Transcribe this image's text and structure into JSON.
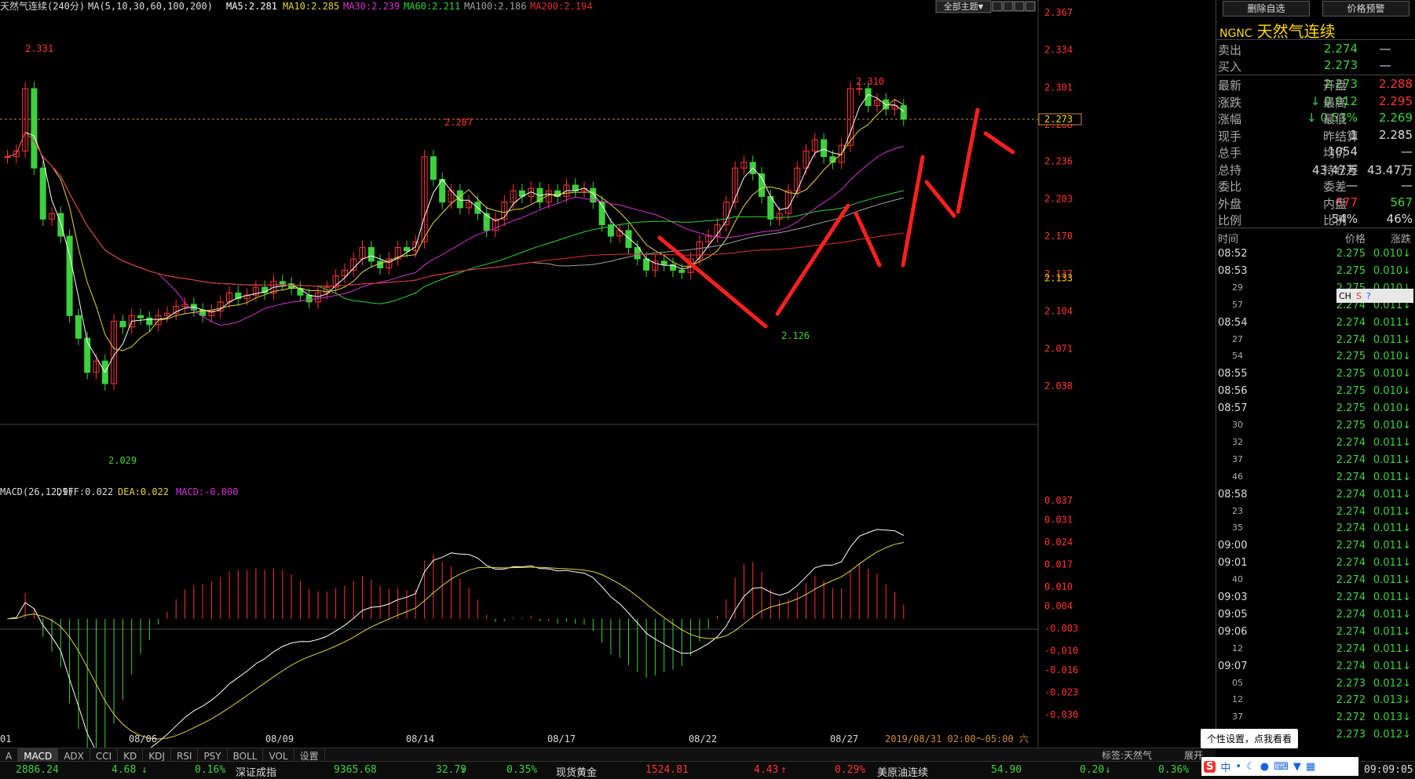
{
  "header": {
    "title": "天然气连续(240分)",
    "ma_label": "MA(5,10,30,60,100,200)",
    "ma5": "MA5:2.281",
    "ma10": "MA10:2.285",
    "ma30": "MA30:2.239",
    "ma60": "MA60:2.211",
    "ma100": "MA100:2.186",
    "ma200": "MA200:2.194",
    "theme_button": "全部主题▼"
  },
  "colors": {
    "up": "#ff3333",
    "down": "#3dd13d",
    "ma5": "#ffffff",
    "ma10": "#e6d23a",
    "ma30": "#d62fd6",
    "ma60": "#2fd62f",
    "ma100": "#a0a0a0",
    "ma200": "#e03030",
    "accent": "#ffd700"
  },
  "price_axis": [
    "2.367",
    "2.334",
    "2.301",
    "2.268",
    "2.236",
    "2.203",
    "2.170",
    "2.137",
    "2.104",
    "2.071",
    "2.038"
  ],
  "price_axis_current": "2.273",
  "price_axis_low": "2.133",
  "annotations": {
    "high1": "2.331",
    "high2": "2.287",
    "high3": "2.310",
    "low1": "2.029",
    "low2": "2.126"
  },
  "dates": [
    "01",
    "08/06",
    "08/09",
    "08/14",
    "08/17",
    "08/22",
    "08/27"
  ],
  "date_range": "2019/08/31 02:00～05:00 六",
  "macd": {
    "label": "MACD(26,12,9)",
    "diff": "DIFF:0.022",
    "dea": "DEA:0.022",
    "macd": "MACD:-0.000",
    "axis": [
      "0.037",
      "0.031",
      "0.024",
      "0.017",
      "0.010",
      "0.004",
      "-0.003",
      "-0.010",
      "-0.016",
      "-0.023",
      "-0.030"
    ]
  },
  "bottom_tabs": [
    "A",
    "MACD",
    "ADX",
    "CCI",
    "KD",
    "KDJ",
    "RSI",
    "PSY",
    "BOLL",
    "VOL",
    "设置"
  ],
  "right_panel": {
    "buttons": [
      "删除自选",
      "价格预警"
    ],
    "code": "NGNC",
    "name": "天然气连续",
    "sell_label": "卖出",
    "sell": "2.274",
    "sell_vol": "—",
    "buy_label": "买入",
    "buy": "2.273",
    "buy_vol": "—",
    "rows": [
      {
        "l1": "最新",
        "v1": "2.273",
        "l2": "开盘",
        "v2": "2.288",
        "c1": "#3dd13d",
        "c2": "#ff3333"
      },
      {
        "l1": "涨跌",
        "v1": "0.012",
        "l2": "最高",
        "v2": "2.295",
        "c1": "#3dd13d",
        "c2": "#ff3333",
        "arrow": "↓"
      },
      {
        "l1": "涨幅",
        "v1": "0.53%",
        "l2": "最低",
        "v2": "2.269",
        "c1": "#3dd13d",
        "c2": "#3dd13d",
        "arrow": "↓"
      },
      {
        "l1": "现手",
        "v1": "1",
        "l2": "昨结算",
        "v2": "2.285",
        "c1": "#ddd",
        "c2": "#ddd"
      },
      {
        "l1": "总手",
        "v1": "1054",
        "l2": "均价",
        "v2": "—",
        "c1": "#ddd",
        "c2": "#ddd"
      },
      {
        "l1": "总持",
        "v1": "43.47万",
        "l2": "持仓差",
        "v2": "43.47万",
        "c1": "#ddd",
        "c2": "#ddd"
      },
      {
        "l1": "委比",
        "v1": "—",
        "l2": "委差",
        "v2": "—",
        "c1": "#ddd",
        "c2": "#ddd"
      },
      {
        "l1": "外盘",
        "v1": "677",
        "l2": "内盘",
        "v2": "567",
        "c1": "#ff3333",
        "c2": "#3dd13d"
      },
      {
        "l1": "比例",
        "v1": "54%",
        "l2": "比例",
        "v2": "46%",
        "c1": "#ddd",
        "c2": "#ddd"
      }
    ],
    "tick_header": {
      "time": "时间",
      "price": "价格",
      "chg": "涨跌"
    },
    "ticks": [
      {
        "t": "08:52",
        "p": "2.275",
        "c": "0.010"
      },
      {
        "t": "08:53",
        "p": "2.275",
        "c": "0.010"
      },
      {
        "t": "29",
        "p": "2.275",
        "c": "0.010",
        "sub": true
      },
      {
        "t": "57",
        "p": "2.274",
        "c": "0.011",
        "sub": true
      },
      {
        "t": "08:54",
        "p": "2.274",
        "c": "0.011"
      },
      {
        "t": "27",
        "p": "2.274",
        "c": "0.011",
        "sub": true
      },
      {
        "t": "54",
        "p": "2.275",
        "c": "0.010",
        "sub": true
      },
      {
        "t": "08:55",
        "p": "2.275",
        "c": "0.010"
      },
      {
        "t": "08:56",
        "p": "2.275",
        "c": "0.010"
      },
      {
        "t": "08:57",
        "p": "2.275",
        "c": "0.010"
      },
      {
        "t": "30",
        "p": "2.275",
        "c": "0.010",
        "sub": true
      },
      {
        "t": "32",
        "p": "2.274",
        "c": "0.011",
        "sub": true
      },
      {
        "t": "37",
        "p": "2.274",
        "c": "0.011",
        "sub": true
      },
      {
        "t": "46",
        "p": "2.274",
        "c": "0.011",
        "sub": true
      },
      {
        "t": "08:58",
        "p": "2.274",
        "c": "0.011"
      },
      {
        "t": "23",
        "p": "2.274",
        "c": "0.011",
        "sub": true
      },
      {
        "t": "35",
        "p": "2.274",
        "c": "0.011",
        "sub": true
      },
      {
        "t": "09:00",
        "p": "2.274",
        "c": "0.011"
      },
      {
        "t": "09:01",
        "p": "2.274",
        "c": "0.011"
      },
      {
        "t": "40",
        "p": "2.274",
        "c": "0.011",
        "sub": true
      },
      {
        "t": "09:03",
        "p": "2.274",
        "c": "0.011"
      },
      {
        "t": "09:05",
        "p": "2.274",
        "c": "0.011"
      },
      {
        "t": "09:06",
        "p": "2.274",
        "c": "0.011"
      },
      {
        "t": "12",
        "p": "2.274",
        "c": "0.011",
        "sub": true
      },
      {
        "t": "09:07",
        "p": "2.274",
        "c": "0.011"
      },
      {
        "t": "05",
        "p": "2.273",
        "c": "0.012",
        "sub": true
      },
      {
        "t": "12",
        "p": "2.272",
        "c": "0.013",
        "sub": true
      },
      {
        "t": "37",
        "p": "2.272",
        "c": "0.013",
        "sub": true
      },
      {
        "t": "",
        "p": "2.273",
        "c": "0.012",
        "sub": true
      }
    ]
  },
  "tag_label": "标签:天然气",
  "expand_label": "展开",
  "tooltip": "个性设置，点我看看",
  "ch_badge": "CH",
  "status": {
    "v1": "2886.24",
    "c1": "4.68",
    "p1": "0.16%",
    "n2": "深证成指",
    "v2": "9365.68",
    "c2": "32.79",
    "p2": "0.35%",
    "n3": "现货黄金",
    "v3": "1524.81",
    "c3": "4.43",
    "p3": "0.29%",
    "n4": "美原油连续",
    "v4": "54.90",
    "c4": "0.20",
    "p4": "0.36%",
    "time": "09:09:05"
  }
}
